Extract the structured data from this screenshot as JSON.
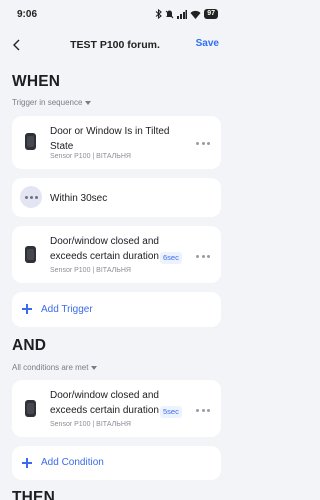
{
  "status_bar": {
    "time": "9:06",
    "battery": "97"
  },
  "header": {
    "title": "TEST P100 forum.",
    "save_label": "Save"
  },
  "when": {
    "title": "WHEN",
    "subtitle": "Trigger in sequence",
    "triggers": [
      {
        "title": "Door or Window Is in Tilted State",
        "subtitle": "Sensor P100 | ВІТАЛЬНЯ",
        "icon": "sensor-device-icon"
      },
      {
        "title": "Within 30sec",
        "icon": "more-dots-icon"
      },
      {
        "title": "Door/window closed and exceeds certain duration",
        "tag": "6sec",
        "subtitle": "Sensor P100 | ВІТАЛЬНЯ",
        "icon": "sensor-device-icon"
      }
    ],
    "add_label": "Add Trigger"
  },
  "and": {
    "title": "AND",
    "subtitle": "All conditions are met",
    "conditions": [
      {
        "title": "Door/window closed and exceeds certain duration",
        "tag": "5sec",
        "subtitle": "Sensor P100 | ВІТАЛЬНЯ",
        "icon": "sensor-device-icon"
      }
    ],
    "add_label": "Add Condition"
  },
  "then": {
    "title": "THEN"
  },
  "colors": {
    "accent": "#3b6bea",
    "save": "#2f6ff6",
    "background": "#f3f4f8",
    "card": "#ffffff"
  }
}
